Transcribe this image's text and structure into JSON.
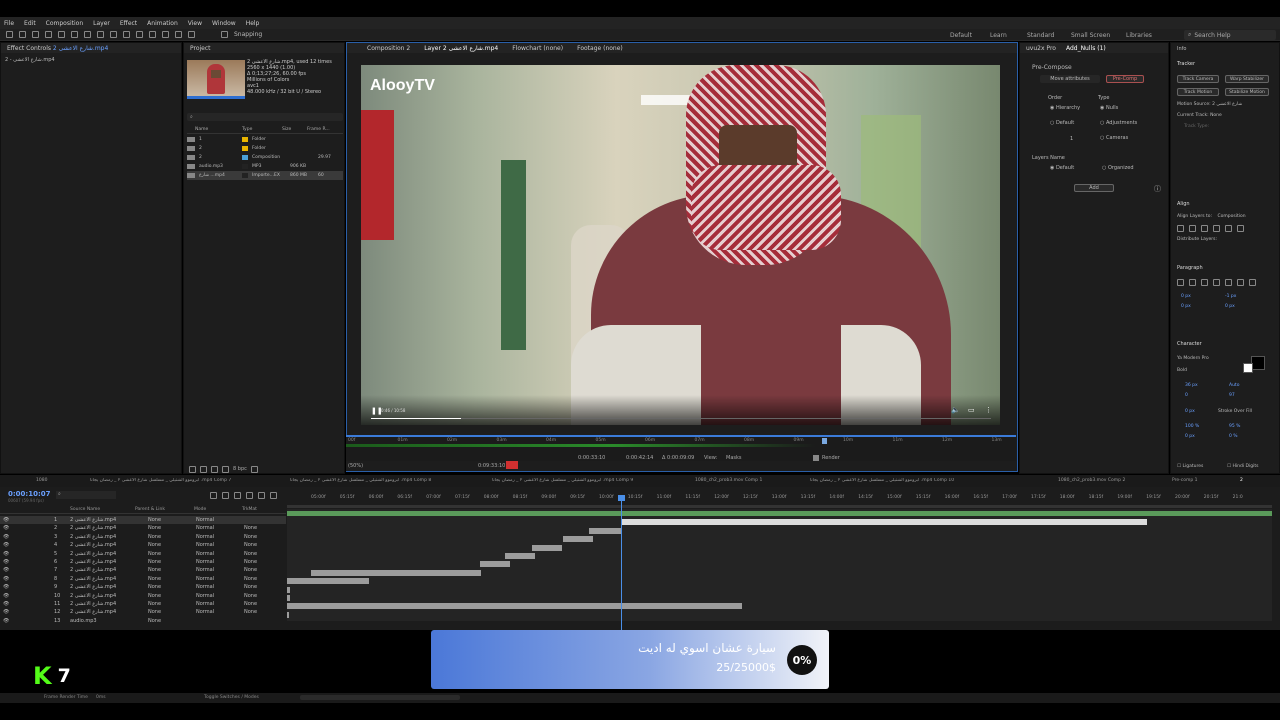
{
  "menu": [
    "File",
    "Edit",
    "Composition",
    "Layer",
    "Effect",
    "Animation",
    "View",
    "Window",
    "Help"
  ],
  "toolbar": {
    "snapping": "Snapping"
  },
  "workspaces": [
    "Default",
    "Learn",
    "Standard",
    "Small Screen",
    "Libraries"
  ],
  "search_help": "Search Help",
  "effect_controls": {
    "tab": "Effect Controls",
    "tab_file": "2 شارع الاعشى.mp4",
    "layer_label": "2 - شارع الاعشى.mp4"
  },
  "project": {
    "tab": "Project",
    "file_name": "2 شارع الاعشى.mp4",
    "used": ", used 12 times",
    "info": [
      "2560 x 1440 (1.00)",
      "Δ 0;13;27;26, 60.00 fps",
      "Millions of Colors",
      "avc1",
      "48.000 kHz / 32 bit U / Stereo"
    ],
    "columns": [
      "Name",
      "Type",
      "Size",
      "Frame R..."
    ],
    "items": [
      {
        "name": "1",
        "type": "Folder",
        "size": "",
        "fr": ""
      },
      {
        "name": "2",
        "type": "Folder",
        "size": "",
        "fr": ""
      },
      {
        "name": "2",
        "type": "Composition",
        "size": "",
        "fr": "29.97"
      },
      {
        "name": "audio.mp3",
        "type": "MP3",
        "size": "906 KB",
        "fr": ""
      },
      {
        "name": "شارع ...mp4",
        "type": "Importe...EX",
        "size": "860 MB",
        "fr": "60"
      }
    ],
    "bpc": "8 bpc"
  },
  "viewer": {
    "tabs": [
      "Composition 2",
      "Layer 2 شارع الاعشى.mp4",
      "Flowchart (none)",
      "Footage (none)"
    ],
    "watermark": "AlooyTV",
    "time_labels": [
      "00f",
      "01m",
      "02m",
      "03m",
      "04m",
      "05m",
      "06m",
      "07m",
      "08m",
      "09m",
      "10m",
      "11m",
      "12m",
      "13m"
    ],
    "zoom": "(50%)",
    "timecode_in": "0:00:33:10",
    "timecode_out": "0:00:42:14",
    "duration": "Δ 0:00:09:09",
    "view_label": "View:",
    "view_value": "Masks",
    "render": "Render",
    "current_time": "0:09:33:10"
  },
  "right_top": {
    "tabs": [
      "uvu2x Pro",
      "Add_Nulls (1)"
    ],
    "precompose": "Pre-Compose",
    "move_attr": "Move attributes",
    "precomp_btn": "Pre-Comp",
    "order": "Order",
    "type": "Type",
    "hierarchy": "Hierarchy",
    "nulls": "Nulls",
    "default": "Default",
    "adjustments": "Adjustments",
    "cameras": "Cameras",
    "layers_name": "Layers Name",
    "default2": "Default",
    "organized": "Organized",
    "add": "Add",
    "one": "1"
  },
  "right_side": {
    "info": "Info",
    "tracker": "Tracker",
    "track_camera": "Track Camera",
    "warp_stabilizer": "Warp Stabilizer",
    "track_motion": "Track Motion",
    "stabilize_motion": "Stabilize Motion",
    "motion_source": "Motion Source:",
    "motion_source_val": "2 شارع الاعشى",
    "current_track": "Current Track:",
    "current_track_val": "None",
    "track_type": "Track Type:",
    "align": "Align",
    "align_to": "Align Layers to:",
    "align_to_val": "Composition",
    "distribute": "Distribute Layers:",
    "paragraph": "Paragraph",
    "para_vals": [
      "0 px",
      "-1 px",
      "0 px",
      "0 px",
      "0 px",
      "0 px"
    ],
    "character": "Character",
    "font": "Ya Modern Pro",
    "style": "Bold",
    "char_vals": [
      "36 px",
      "Auto",
      "0",
      "97",
      "0 px",
      "Stroke Over Fill",
      "100 %",
      "95 %",
      "0 px",
      "0 %"
    ],
    "ligatures": "Ligatures",
    "hindi": "Hindi Digits"
  },
  "timeline": {
    "tabs": [
      "1080",
      "أبروموو الشتيلي _ مسلسل شارع الاعشى ٢ _ رمضان يجانا .mp4 Comp 7",
      "أبروموو الشتيلي _ مسلسل شارع الاعشى ٢ _ رمضان يجانا .mp4 Comp 8",
      "أبروموو الشتيلي _ مسلسل شارع الاعشى ٢ _ رمضان يجانا .mp4 Comp 9",
      "1080_ch2_prob3.mov Comp 1",
      "أبروموو الشتيلي _ مسلسل شارع الاعشى ٢ _ رمضان يجانا .mp4 Comp 10",
      "1080_ch2_prob3.mov Comp 2",
      "Pre-comp 1",
      "2"
    ],
    "current_time": "0:00:10:07",
    "fps": "00607 (59.94 fps)",
    "cols": [
      "Source Name",
      "Parent & Link",
      "Mode",
      "TrkMat"
    ],
    "ruler": [
      "05:00f",
      "05:15f",
      "06:00f",
      "06:15f",
      "07:00f",
      "07:15f",
      "08:00f",
      "08:15f",
      "09:00f",
      "09:15f",
      "10:00f",
      "10:15f",
      "11:00f",
      "11:15f",
      "12:00f",
      "12:15f",
      "13:00f",
      "13:15f",
      "14:00f",
      "14:15f",
      "15:00f",
      "15:15f",
      "16:00f",
      "16:15f",
      "17:00f",
      "17:15f",
      "18:00f",
      "18:15f",
      "19:00f",
      "19:15f",
      "20:00f",
      "20:15f",
      "21:0"
    ],
    "layers": [
      {
        "n": "1",
        "name": "2 شارع الاعشى.mp4",
        "parent": "None",
        "mode": "Normal",
        "trk": ""
      },
      {
        "n": "2",
        "name": "2 شارع الاعشى.mp4",
        "parent": "None",
        "mode": "Normal",
        "trk": "None"
      },
      {
        "n": "3",
        "name": "2 شارع الاعشى.mp4",
        "parent": "None",
        "mode": "Normal",
        "trk": "None"
      },
      {
        "n": "4",
        "name": "2 شارع الاعشى.mp4",
        "parent": "None",
        "mode": "Normal",
        "trk": "None"
      },
      {
        "n": "5",
        "name": "2 شارع الاعشى.mp4",
        "parent": "None",
        "mode": "Normal",
        "trk": "None"
      },
      {
        "n": "6",
        "name": "2 شارع الاعشى.mp4",
        "parent": "None",
        "mode": "Normal",
        "trk": "None"
      },
      {
        "n": "7",
        "name": "2 شارع الاعشى.mp4",
        "parent": "None",
        "mode": "Normal",
        "trk": "None"
      },
      {
        "n": "8",
        "name": "2 شارع الاعشى.mp4",
        "parent": "None",
        "mode": "Normal",
        "trk": "None"
      },
      {
        "n": "9",
        "name": "2 شارع الاعشى.mp4",
        "parent": "None",
        "mode": "Normal",
        "trk": "None"
      },
      {
        "n": "10",
        "name": "2 شارع الاعشى.mp4",
        "parent": "None",
        "mode": "Normal",
        "trk": "None"
      },
      {
        "n": "11",
        "name": "2 شارع الاعشى.mp4",
        "parent": "None",
        "mode": "Normal",
        "trk": "None"
      },
      {
        "n": "12",
        "name": "2 شارع الاعشى.mp4",
        "parent": "None",
        "mode": "Normal",
        "trk": "None"
      },
      {
        "n": "13",
        "name": "audio.mp3",
        "parent": "None",
        "mode": "",
        "trk": ""
      }
    ],
    "frame_render": "Frame Render Time",
    "frame_render_val": "0ms",
    "toggle": "Toggle Switches / Modes"
  },
  "donation": {
    "title": "سيارة عشان اسوي له اديت",
    "amount": "25/25000$",
    "percent": "0%",
    "progress": 0
  },
  "logo": {
    "letter": "K",
    "count": "7",
    "color": "#53fc18"
  }
}
